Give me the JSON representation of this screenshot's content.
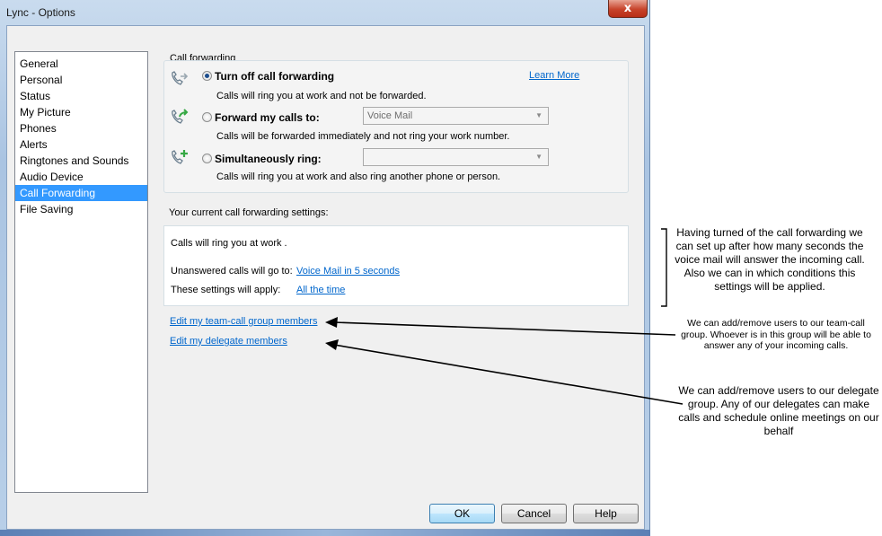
{
  "window": {
    "title": "Lync - Options",
    "close_glyph": "x"
  },
  "nav": {
    "items": [
      {
        "label": "General"
      },
      {
        "label": "Personal"
      },
      {
        "label": "Status"
      },
      {
        "label": "My Picture"
      },
      {
        "label": "Phones"
      },
      {
        "label": "Alerts"
      },
      {
        "label": "Ringtones and Sounds"
      },
      {
        "label": "Audio Device"
      },
      {
        "label": "Call Forwarding",
        "selected": true
      },
      {
        "label": "File Saving"
      }
    ]
  },
  "call_forwarding": {
    "group_label": "Call forwarding",
    "learn_more": "Learn More",
    "options": [
      {
        "label": "Turn off call forwarding",
        "description": "Calls will ring you at work and not be forwarded.",
        "checked": true,
        "icon": "phone-arrow-icon"
      },
      {
        "label": "Forward my calls to:",
        "description": "Calls will be forwarded immediately and not ring your work number.",
        "checked": false,
        "icon": "phone-forward-icon",
        "combo_value": "Voice Mail"
      },
      {
        "label": "Simultaneously ring:",
        "description": "Calls will ring you at work and also ring another phone or person.",
        "checked": false,
        "icon": "phone-add-icon",
        "combo_value": ""
      }
    ]
  },
  "current_settings": {
    "heading": "Your current call forwarding settings:",
    "summary": "Calls will ring you at work .",
    "unanswered_label": "Unanswered calls will go to:",
    "unanswered_value": "Voice Mail in 5 seconds",
    "apply_label": "These settings will apply:",
    "apply_value": "All the time"
  },
  "links": {
    "team_call": "Edit my team-call group members",
    "delegates": "Edit my delegate members"
  },
  "buttons": {
    "ok": "OK",
    "cancel": "Cancel",
    "help": "Help"
  },
  "annotations": {
    "settings_note": "Having turned of the call forwarding we can set up after how many seconds the voice mail will answer the incoming call. Also we can in which conditions this settings will be applied.",
    "team_note": "We can add/remove users to our team-call group. Whoever is in this group will be able to answer any of your incoming calls.",
    "delegate_note": "We can add/remove users to our delegate group. Any of our delegates can make calls and schedule online meetings on our behalf"
  },
  "colors": {
    "selection": "#3399ff",
    "link": "#0066cc",
    "close_button": "#c7432a"
  }
}
